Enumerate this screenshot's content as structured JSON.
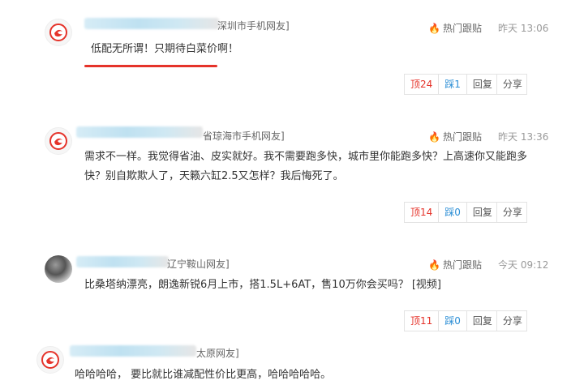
{
  "hot_label": "热门跟贴",
  "icons": {
    "avatar": "netease-logo-icon",
    "hot": "flame-icon"
  },
  "colors": {
    "accent": "#e5332a",
    "up": "#e5332a",
    "down": "#2d8fd6"
  },
  "comments": [
    {
      "user_location": "深圳市手机网友]",
      "time": "昨天 13:06",
      "text": "低配无所谓！只期待白菜价啊！",
      "up_label": "顶24",
      "down_label": "踩1",
      "reply_label": "回复",
      "share_label": "分享"
    },
    {
      "user_location": "省琼海市手机网友]",
      "time": "昨天 13:36",
      "text_lines": [
        "需求不一样。我觉得省油、皮实就好。我不需要跑多快，城市里你能跑多快？上高速你又能跑多",
        "快？别自欺欺人了，天籁六缸2.5又怎样？我后悔死了。"
      ],
      "up_label": "顶14",
      "down_label": "踩0",
      "reply_label": "回复",
      "share_label": "分享"
    },
    {
      "user_location": "辽宁鞍山网友]",
      "time": "今天 09:12",
      "text": "比桑塔纳漂亮，朗逸新锐6月上市，搭1.5L+6AT，售10万你会买吗？ [视频]",
      "up_label": "顶11",
      "down_label": "踩0",
      "reply_label": "回复",
      "share_label": "分享"
    },
    {
      "user_location": "太原网友]",
      "text": "哈哈哈哈， 要比就比谁减配性价比更高，哈哈哈哈哈。"
    }
  ]
}
